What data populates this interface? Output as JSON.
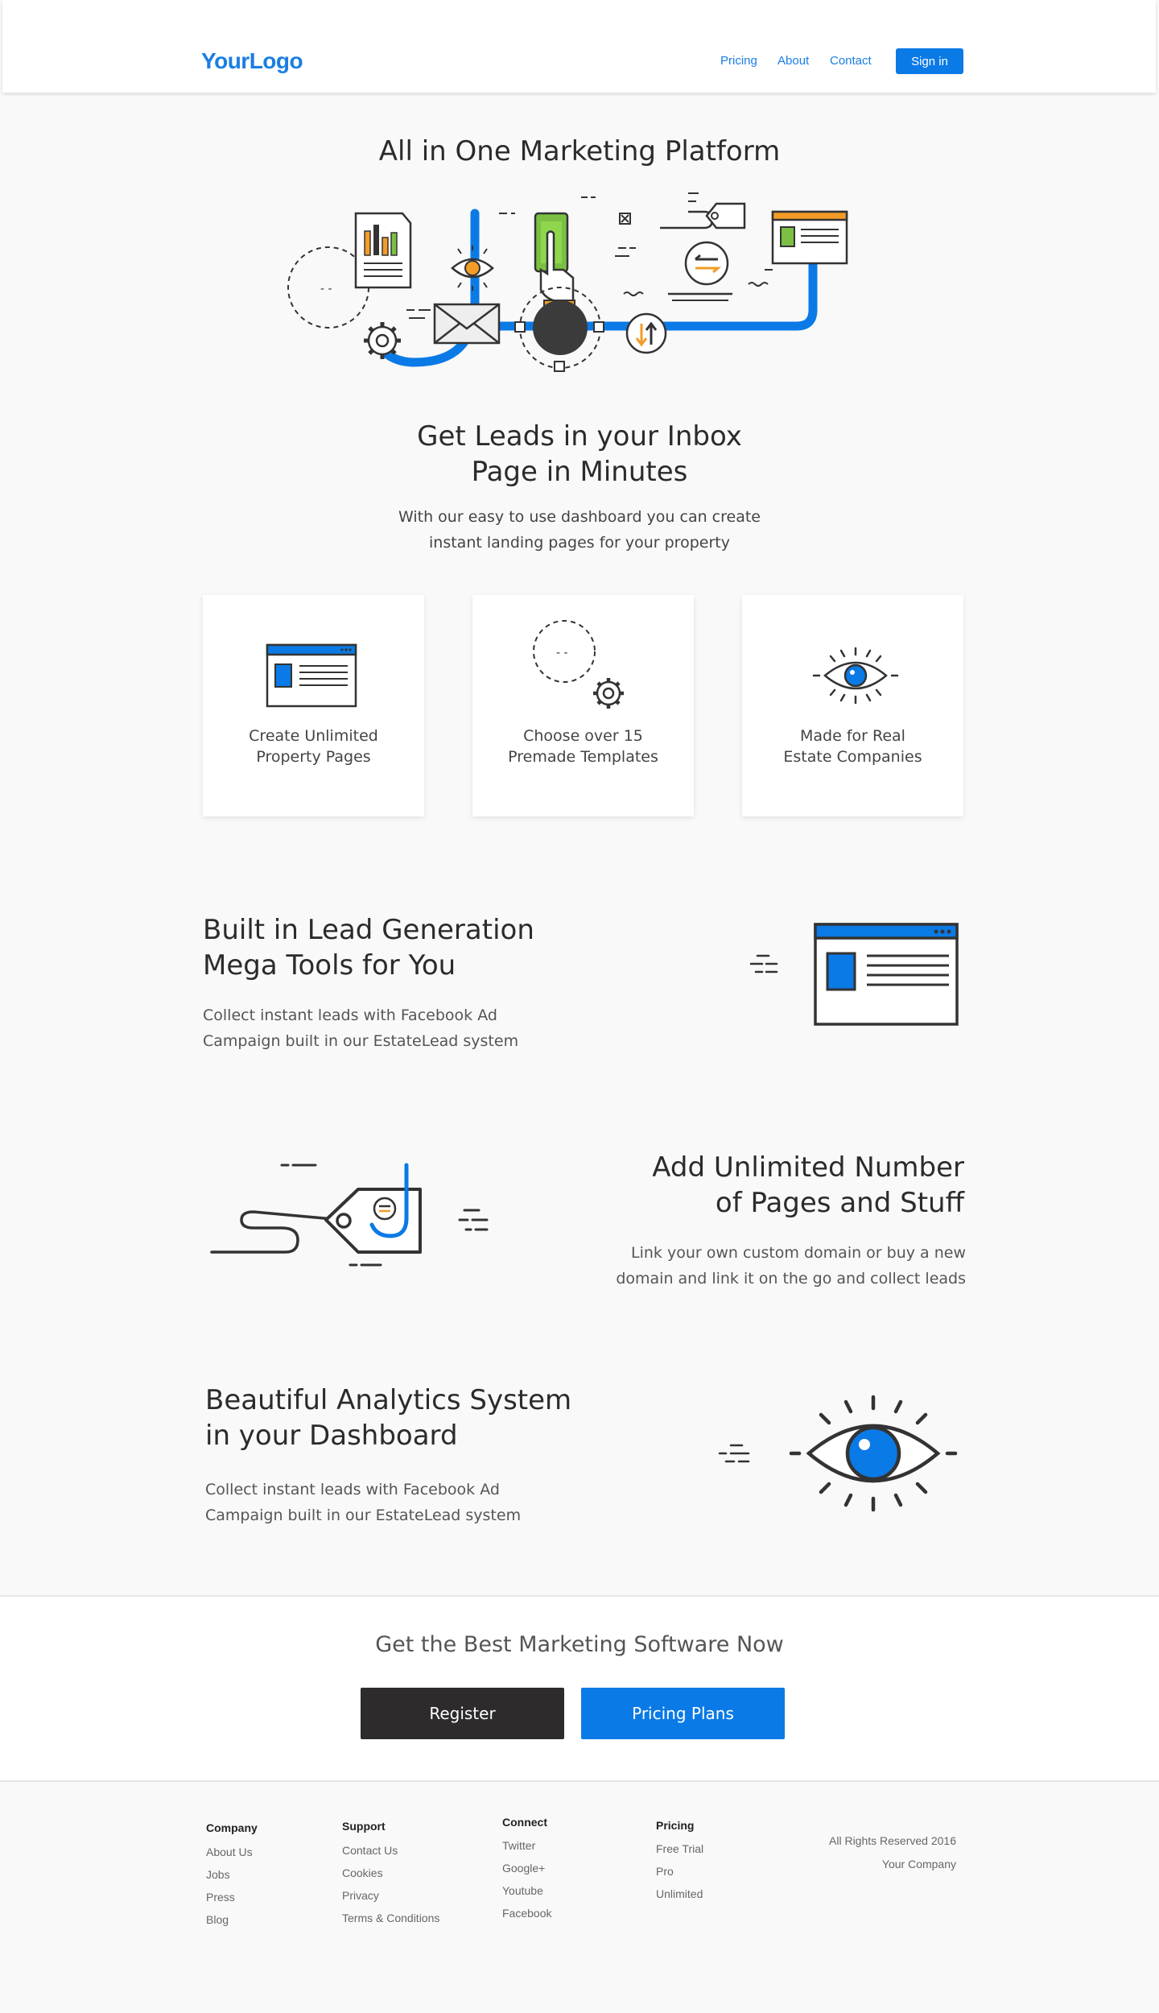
{
  "header": {
    "logo": "YourLogo",
    "nav": [
      "Pricing",
      "About",
      "Contact"
    ],
    "signin": "Sign in"
  },
  "hero": {
    "title": "All in One Marketing Platform"
  },
  "intro": {
    "title_line1": "Get Leads in your Inbox",
    "title_line2": "Page in Minutes",
    "sub_line1": "With our easy to use dashboard you can create",
    "sub_line2": "instant landing pages for your property"
  },
  "cards": [
    {
      "label": "Create Unlimited\nProperty Pages",
      "icon": "browser-window-icon"
    },
    {
      "label": "Choose over 15\nPremade Templates",
      "icon": "gear-icon"
    },
    {
      "label": "Made for Real\nEstate Companies",
      "icon": "eye-icon"
    }
  ],
  "features": [
    {
      "title": "Built in Lead Generation\nMega Tools for You",
      "text": "Collect instant leads with Facebook Ad\nCampaign built in our EstateLead system",
      "icon": "browser-window-icon"
    },
    {
      "title": "Add Unlimited Number\nof Pages and Stuff",
      "text": "Link your own custom domain or buy a new\ndomain and link it on the go and collect leads",
      "icon": "price-tag-icon"
    },
    {
      "title": "Beautiful Analytics System\nin your Dashboard",
      "text": "Collect instant leads with Facebook Ad\nCampaign built in our EstateLead system",
      "icon": "eye-icon"
    }
  ],
  "cta": {
    "title": "Get the Best Marketing Software Now",
    "register": "Register",
    "pricing": "Pricing Plans"
  },
  "footer": {
    "columns": [
      {
        "heading": "Company",
        "links": [
          "About Us",
          "Jobs",
          "Press",
          "Blog"
        ]
      },
      {
        "heading": "Support",
        "links": [
          "Contact Us",
          "Cookies",
          "Privacy",
          "Terms & Conditions"
        ]
      },
      {
        "heading": "Connect",
        "links": [
          "Twitter",
          "Google+",
          "Youtube",
          "Facebook"
        ]
      },
      {
        "heading": "Pricing",
        "links": [
          "Free Trial",
          "Pro",
          "Unlimited"
        ]
      }
    ],
    "rights": "All Rights Reserved 2016",
    "company": "Your Company"
  },
  "colors": {
    "accent": "#0a7ae6",
    "dark": "#2d2b2b",
    "orange": "#f39c27",
    "green": "#7bc043"
  }
}
